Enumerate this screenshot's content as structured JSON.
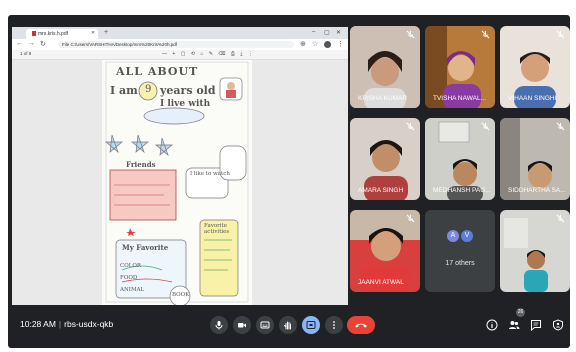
{
  "browser": {
    "tab_title": "mrs.kris.h.pdf",
    "url": "File  C:/Users/VARSHITHA/Desktop/mrs%20Kris%20h.pdf",
    "pdf_page": "1 of 8"
  },
  "worksheet": {
    "title": "ALL ABOUT",
    "line1": "I am",
    "age": "9",
    "line1b": "years old",
    "line2": "I live with",
    "friends": "Friends",
    "favorite": "My Favorite",
    "color": "COLOR",
    "food": "FOOD",
    "animal": "ANIMAL",
    "favorite_activities": "Favorite activities",
    "book": "BOOK",
    "i_like": "I like to watch"
  },
  "participants": [
    {
      "name": "KRISHA KUMAR",
      "muted": true
    },
    {
      "name": "TVISHA NAWAL...",
      "muted": true
    },
    {
      "name": "VIHAAN SINGHI",
      "muted": true
    },
    {
      "name": "AMARA SINGH",
      "muted": true
    },
    {
      "name": "MEDHANSH PAG...",
      "muted": true
    },
    {
      "name": "SIDDHARTHA SA...",
      "muted": true
    },
    {
      "name": "JAANVI ATWAL",
      "muted": true
    },
    {
      "name": "",
      "muted": true
    }
  ],
  "others": {
    "count_label": "17 others",
    "avatar_a": "A",
    "avatar_v": "V"
  },
  "bottom_bar": {
    "time": "10:28 AM",
    "meeting_code": "rbs-usdx-qkb",
    "people_count": "26"
  },
  "colors": {
    "meet_bg": "#202124",
    "tile_bg": "#3c4043",
    "end_call": "#ea4335",
    "avatar_a": "#7b8ae0",
    "avatar_v": "#5b7fd6"
  }
}
